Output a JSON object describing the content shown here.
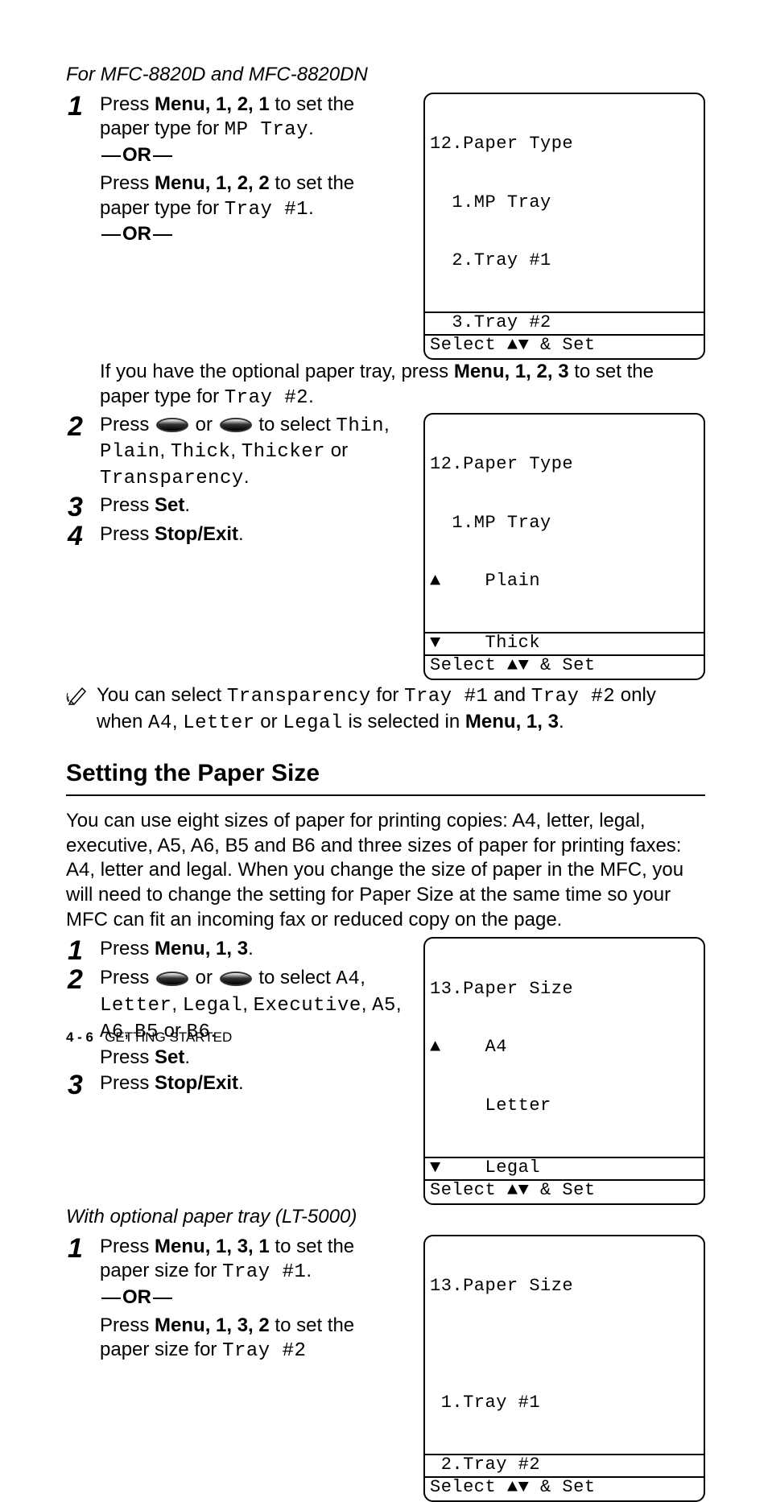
{
  "model_heading": "For MFC-8820D and MFC-8820DN",
  "paper_type": {
    "step1_a_pre": "Press ",
    "step1_a_menu": "Menu",
    "step1_a_keys": ", 1, 2, 1 ",
    "step1_a_post": "to set the paper type for ",
    "step1_a_tray": "MP Tray",
    "step1_a_end": ".",
    "or": "OR",
    "step1_b_pre": "Press ",
    "step1_b_menu": "Menu",
    "step1_b_keys": ", 1, 2, 2 ",
    "step1_b_post": "to set the paper type for ",
    "step1_b_tray": "Tray #1",
    "step1_b_end": ".",
    "step1_c_pre": "If you have the optional paper tray, press ",
    "step1_c_menu": "Menu",
    "step1_c_keys": ", 1, 2, 3 ",
    "step1_c_post": "to set the paper type for ",
    "step1_c_tray": "Tray #2",
    "step1_c_end": ".",
    "step2_pre": "Press ",
    "step2_mid": " or ",
    "step2_post": " to select ",
    "step2_opt1": "Thin",
    "step2_sep1": ", ",
    "step2_opt2": "Plain",
    "step2_sep2": ", ",
    "step2_opt3": "Thick",
    "step2_sep3": ", ",
    "step2_opt4": "Thicker",
    "step2_sep4": " or ",
    "step2_opt5": "Transparency",
    "step2_end": ".",
    "step3_pre": "Press ",
    "step3_btn": "Set",
    "step3_end": ".",
    "step4_pre": "Press ",
    "step4_btn": "Stop/Exit",
    "step4_end": "."
  },
  "note": {
    "pre": "You can select ",
    "t1": "Transparency",
    "mid1": " for ",
    "t2": "Tray #1",
    "mid2": " and ",
    "t3": "Tray #2",
    "mid3": " only when ",
    "o1": "A4",
    "s1": ", ",
    "o2": "Letter",
    "s2": " or ",
    "o3": "Legal",
    "mid4": " is selected in ",
    "menu": "Menu",
    "keys": ", 1, 3",
    "end": "."
  },
  "section_title": "Setting the Paper Size",
  "size_intro": "You can use eight sizes of paper for printing copies: A4, letter, legal, executive, A5, A6, B5 and B6 and three sizes of paper for printing faxes: A4, letter and legal. When you change the size of paper in the MFC, you will need to change the setting for Paper Size at the same time so your MFC can fit an incoming fax or reduced copy on the page.",
  "size": {
    "step1_pre": "Press ",
    "step1_menu": "Menu",
    "step1_keys": ", 1, 3",
    "step1_end": ".",
    "step2_pre": "Press ",
    "step2_mid": " or ",
    "step2_post": " to select ",
    "step2_o1": "A4",
    "step2_s1": ", ",
    "step2_o2": "Letter",
    "step2_s2": ", ",
    "step2_o3": "Legal",
    "step2_s3": ", ",
    "step2_o4": "Executive",
    "step2_s4": ", ",
    "step2_o5": "A5",
    "step2_s5": ", ",
    "step2_o6": "A6",
    "step2_s6": ", ",
    "step2_o7": "B5",
    "step2_s7": " or ",
    "step2_o8": "B6",
    "step2_end": ".",
    "step2_set_pre": "Press ",
    "step2_set": "Set",
    "step2_set_end": ".",
    "step3_pre": "Press ",
    "step3_btn": "Stop/Exit",
    "step3_end": "."
  },
  "optional_heading": "With optional paper tray (LT-5000)",
  "optional": {
    "step1_a_pre": "Press ",
    "step1_a_menu": "Menu",
    "step1_a_keys": ", 1, 3, 1 ",
    "step1_a_post": "to set the paper size for ",
    "step1_a_tray": "Tray #1",
    "step1_a_end": ".",
    "or": "OR",
    "step1_b_pre": "Press ",
    "step1_b_menu": "Menu",
    "step1_b_keys": ", 1, 3, 2 ",
    "step1_b_post": "to set the paper size for ",
    "step1_b_tray": "Tray #2"
  },
  "lcd1": {
    "l1": "12.Paper Type",
    "l2": "  1.MP Tray",
    "l3": "  2.Tray #1",
    "l4": "  3.Tray #2",
    "l5": "Select ▲▼ & Set"
  },
  "lcd2": {
    "l1": "12.Paper Type",
    "l2": "  1.MP Tray",
    "l3": "▲    Plain",
    "l4": "▼    Thick",
    "l5": "Select ▲▼ & Set"
  },
  "lcd3": {
    "l1": "13.Paper Size",
    "l2": "▲    A4",
    "l3": "     Letter",
    "l4": "▼    Legal",
    "l5": "Select ▲▼ & Set"
  },
  "lcd4": {
    "l1": "13.Paper Size",
    "l2": " ",
    "l3": " 1.Tray #1",
    "l4": " 2.Tray #2",
    "l5": "Select ▲▼ & Set"
  },
  "footer": {
    "page": "4 - 6",
    "title": "GETTING STARTED"
  }
}
